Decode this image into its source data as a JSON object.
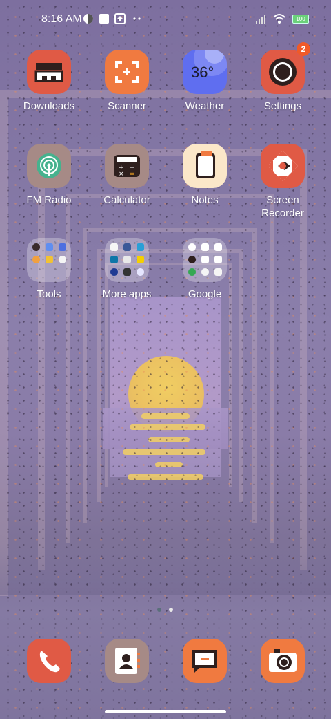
{
  "status_bar": {
    "time": "8:16 AM",
    "battery": "100",
    "icons": [
      "vpn-icon",
      "notification-square-icon",
      "upload-icon",
      "more-dots-icon",
      "signal-icon",
      "wifi-icon",
      "battery-icon"
    ]
  },
  "apps": [
    {
      "label": "Downloads",
      "icon": "downloads-icon",
      "color": "#e05a45"
    },
    {
      "label": "Scanner",
      "icon": "scanner-icon",
      "color": "#f07a40"
    },
    {
      "label": "Weather",
      "icon": "weather-icon",
      "color": "#5f6ef0",
      "value": "36°"
    },
    {
      "label": "Settings",
      "icon": "settings-icon",
      "color": "#e05a45",
      "badge": "2"
    },
    {
      "label": "FM Radio",
      "icon": "fm-radio-icon",
      "color": "#a68a86"
    },
    {
      "label": "Calculator",
      "icon": "calculator-icon",
      "color": "#a68a86"
    },
    {
      "label": "Notes",
      "icon": "notes-icon",
      "color": "#fbe7c9"
    },
    {
      "label": "Screen\nRecorder",
      "icon": "screen-recorder-icon",
      "color": "#e05a45"
    }
  ],
  "folders": [
    {
      "label": "Tools"
    },
    {
      "label": "More apps"
    },
    {
      "label": "Google"
    }
  ],
  "dock": [
    {
      "name": "phone",
      "icon": "phone-icon",
      "color": "#e05a45"
    },
    {
      "name": "contacts",
      "icon": "contacts-icon",
      "color": "#a68a86"
    },
    {
      "name": "messages",
      "icon": "messages-icon",
      "color": "#f07a40"
    },
    {
      "name": "camera",
      "icon": "camera-icon",
      "color": "#f07a40"
    }
  ],
  "pager": {
    "pages": 2,
    "current": 1
  }
}
